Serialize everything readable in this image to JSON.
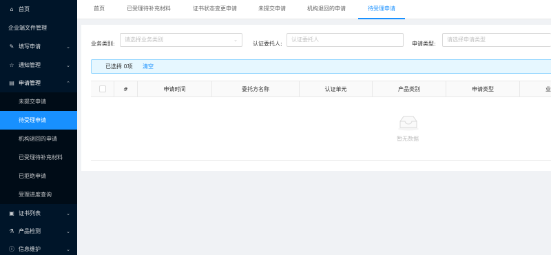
{
  "sidebar": {
    "items": [
      {
        "label": "首页",
        "icon": "home-icon"
      },
      {
        "label": "企业端文件管理",
        "icon": ""
      },
      {
        "label": "填写申请",
        "icon": "edit-icon"
      },
      {
        "label": "通知管理",
        "icon": "pin-icon"
      },
      {
        "label": "申请管理",
        "icon": "file-icon"
      }
    ],
    "submenu": [
      {
        "label": "未提交申请"
      },
      {
        "label": "待受理申请"
      },
      {
        "label": "机构退回的申请"
      },
      {
        "label": "已受理待补充材料"
      },
      {
        "label": "已拒绝申请"
      },
      {
        "label": "受理进度查询"
      }
    ],
    "bottom_items": [
      {
        "label": "证书列表",
        "icon": "list-icon"
      },
      {
        "label": "产品检测",
        "icon": "flask-icon"
      },
      {
        "label": "信息维护",
        "icon": "info-icon"
      }
    ]
  },
  "tabs": [
    {
      "label": "首页"
    },
    {
      "label": "已受理待补充材料"
    },
    {
      "label": "证书状态变更申请"
    },
    {
      "label": "未提交申请"
    },
    {
      "label": "机构退回的申请"
    },
    {
      "label": "待受理申请"
    }
  ],
  "filters": {
    "business_type_label": "业务类别:",
    "business_type_placeholder": "请选择业务类别",
    "client_label": "认证委托人:",
    "client_placeholder": "认证委托人",
    "apply_type_label": "申请类型:",
    "apply_type_placeholder": "请选择申请类型"
  },
  "selection": {
    "selected_text": "已选择 0项",
    "clear_label": "清空"
  },
  "table": {
    "columns": [
      "#",
      "申请时间",
      "委托方名称",
      "认证单元",
      "产品类别",
      "申请类型",
      "业"
    ],
    "empty_text": "暂无数据"
  }
}
